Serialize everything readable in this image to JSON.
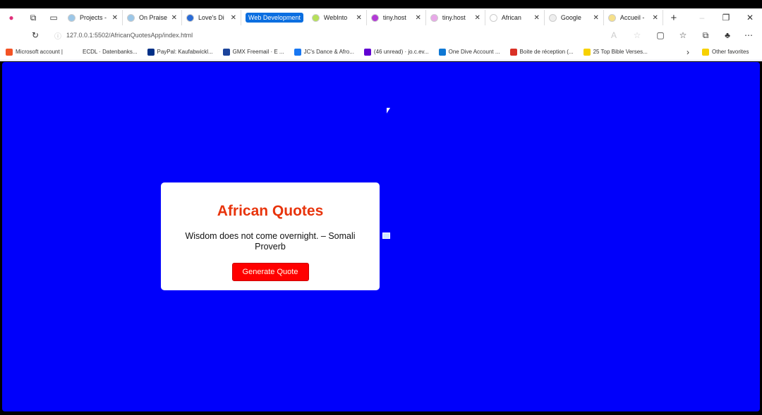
{
  "tabs": [
    {
      "title": "Projects -",
      "color": "#9cc7e8"
    },
    {
      "title": "On Praise",
      "color": "#9cc7e8"
    },
    {
      "title": "Love's Di",
      "color": "#2a6bd6"
    }
  ],
  "tab_group": "Web Development",
  "group_tabs": [
    {
      "title": "WebInto",
      "color": "#b6e05a"
    },
    {
      "title": "tiny.host",
      "color": "#b23ad6"
    },
    {
      "title": "tiny.host",
      "color": "#e8a8e8"
    },
    {
      "title": "African",
      "color": "#ffffff"
    },
    {
      "title": "Google",
      "color": "#eeeeee"
    },
    {
      "title": "Accueil -",
      "color": "#f6e08a"
    }
  ],
  "address": "127.0.0.1:5502/AfricanQuotesApp/index.html",
  "bookmarks": [
    {
      "label": "Microsoft account |",
      "color": "#f35325"
    },
    {
      "label": "ECDL · Datenbanks...",
      "color": "#ffffff"
    },
    {
      "label": "PayPal: Kaufabwickl...",
      "color": "#003087"
    },
    {
      "label": "GMX Freemail · E ...",
      "color": "#1c449b"
    },
    {
      "label": "JC's Dance & Afro...",
      "color": "#1877f2"
    },
    {
      "label": "(46 unread) · jo.c.ev...",
      "color": "#6001d2"
    },
    {
      "label": "One Dive Account ...",
      "color": "#0f78d4"
    },
    {
      "label": "Boite de réception (...",
      "color": "#d93025"
    },
    {
      "label": "25 Top Bible Verses...",
      "color": "#f7d100"
    }
  ],
  "other_favorites": "Other favorites",
  "page": {
    "title": "African Quotes",
    "quote": "Wisdom does not come overnight. – Somali Proverb",
    "button": "Generate Quote",
    "background": "#0000fb"
  }
}
